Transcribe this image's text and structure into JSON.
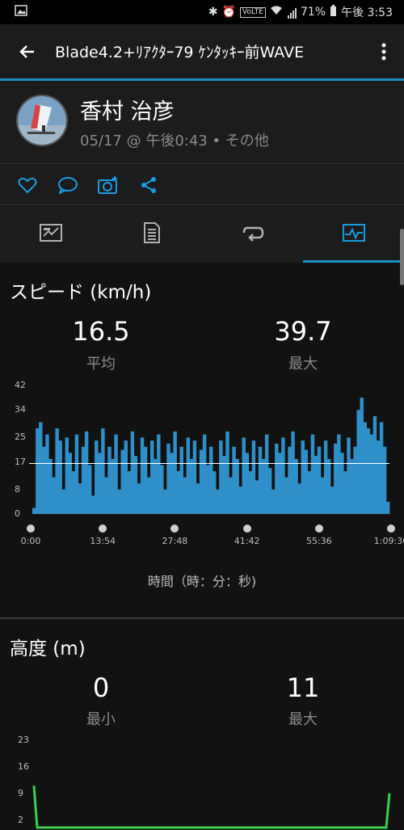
{
  "status": {
    "battery": "71%",
    "time": "午後 3:53",
    "volte": "VoLTE"
  },
  "appbar": {
    "title": "Blade4.2+ﾘｱｸﾀｰ79  ｹﾝﾀｯｷｰ前WAVE"
  },
  "profile": {
    "name": "香村 治彦",
    "meta": "05/17 @ 午後0:43 • その他"
  },
  "speed": {
    "title": "スピード (km/h)",
    "avg_value": "16.5",
    "avg_label": "平均",
    "max_value": "39.7",
    "max_label": "最大",
    "y_ticks": [
      "42",
      "34",
      "25",
      "17",
      "8",
      "0"
    ],
    "x_ticks": [
      "0:00",
      "13:54",
      "27:48",
      "41:42",
      "55:36",
      "1:09:30"
    ],
    "x_axis_label": "時間（時：分：秒)"
  },
  "altitude": {
    "title": "高度 (m)",
    "min_value": "0",
    "min_label": "最小",
    "max_value": "11",
    "max_label": "最大",
    "y_ticks": [
      "23",
      "16",
      "9",
      "2"
    ]
  },
  "colors": {
    "accent": "#1a8fc7",
    "speed_fill": "#2f8fc9",
    "altitude_line": "#3ad04a"
  },
  "chart_data": [
    {
      "type": "area",
      "title": "スピード (km/h)",
      "xlabel": "時間（時：分：秒)",
      "ylabel": "",
      "ylim": [
        0,
        42
      ],
      "x_ticks": [
        "0:00",
        "13:54",
        "27:48",
        "41:42",
        "55:36",
        "1:09:30"
      ],
      "average_line": 16.5,
      "series": [
        {
          "values": [
            2,
            28,
            30,
            22,
            26,
            18,
            12,
            28,
            24,
            8,
            25,
            20,
            14,
            26,
            10,
            22,
            27,
            16,
            6,
            24,
            20,
            28,
            12,
            22,
            18,
            26,
            8,
            21,
            24,
            14,
            27,
            19,
            10,
            25,
            22,
            12,
            24,
            18,
            26,
            16,
            8,
            23,
            20,
            27,
            14,
            22,
            12,
            25,
            18,
            24,
            10,
            21,
            26,
            16,
            22,
            14,
            8,
            24,
            19,
            27,
            12,
            22,
            18,
            9,
            25,
            20,
            14,
            24,
            11,
            22,
            18,
            26,
            15,
            8,
            23,
            20,
            25,
            12,
            22,
            27,
            18,
            10,
            24,
            21,
            14,
            26,
            19,
            22,
            12,
            24,
            18,
            9,
            23,
            26,
            20,
            14,
            25,
            18,
            22,
            34,
            38,
            30,
            28,
            26,
            32,
            24,
            30,
            22,
            4
          ]
        }
      ]
    },
    {
      "type": "line",
      "title": "高度 (m)",
      "ylim": [
        0,
        23
      ],
      "series": [
        {
          "values": [
            11,
            0,
            0,
            0,
            0,
            0,
            0,
            0,
            0,
            0,
            0,
            0,
            0,
            0,
            0,
            0,
            0,
            0,
            0,
            0,
            0,
            0,
            0,
            0,
            0,
            0,
            0,
            0,
            0,
            0,
            0,
            0,
            0,
            0,
            0,
            0,
            0,
            0,
            0,
            0,
            0,
            0,
            0,
            0,
            0,
            0,
            0,
            0,
            0,
            0,
            0,
            0,
            0,
            0,
            0,
            0,
            0,
            0,
            0,
            0,
            0,
            0,
            0,
            0,
            0,
            0,
            0,
            0,
            0,
            0,
            0,
            0,
            0,
            0,
            0,
            0,
            0,
            0,
            0,
            0,
            0,
            0,
            0,
            0,
            0,
            0,
            0,
            0,
            0,
            0,
            0,
            0,
            0,
            0,
            0,
            0,
            0,
            0,
            0,
            0,
            0,
            0,
            0,
            0,
            0,
            0,
            0,
            0,
            0,
            9
          ]
        }
      ]
    }
  ]
}
